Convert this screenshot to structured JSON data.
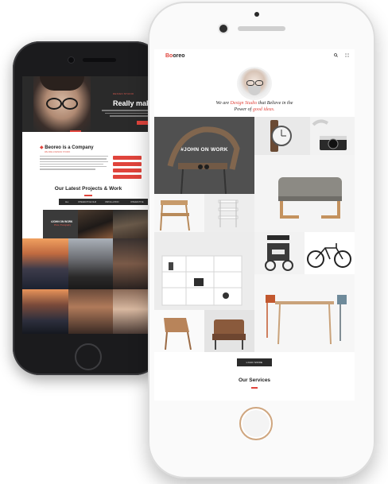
{
  "back_phone": {
    "hero": {
      "kicker": "DESIGN STUDIO",
      "title": "Really mak"
    },
    "company": {
      "title": "Beoreo is a Company",
      "subtitle": "WE ARE A DESIGN STUDIO",
      "buttons": [
        "",
        "",
        "",
        ""
      ]
    },
    "projects": {
      "title": "Our Latest Projects & Work",
      "filters": [
        "ALL",
        "INTERACTIVE FILM",
        "INSTALLATION",
        "INTERACTIVE"
      ]
    },
    "john_card": {
      "title": "#JOHN ON WORK",
      "subtitle": "Photo, Photography"
    }
  },
  "front_phone": {
    "nav": {
      "logo_first": "Bo",
      "logo_rest": "oreo",
      "search_icon": "search-icon",
      "menu_icon": "menu-icon"
    },
    "intro": {
      "line1_prefix": "We are ",
      "line1_highlight": "Design Studio",
      "line1_suffix": " that Believe in the",
      "line2_prefix": "Power of ",
      "line2_highlight": "good ideas."
    },
    "portfolio": {
      "featured_title": "#JOHN ON WORK"
    },
    "load_more_label": "LOAD MORE",
    "services_title": "Our Services"
  },
  "colors": {
    "accent": "#e0443c",
    "dark": "#2b2b2b"
  }
}
